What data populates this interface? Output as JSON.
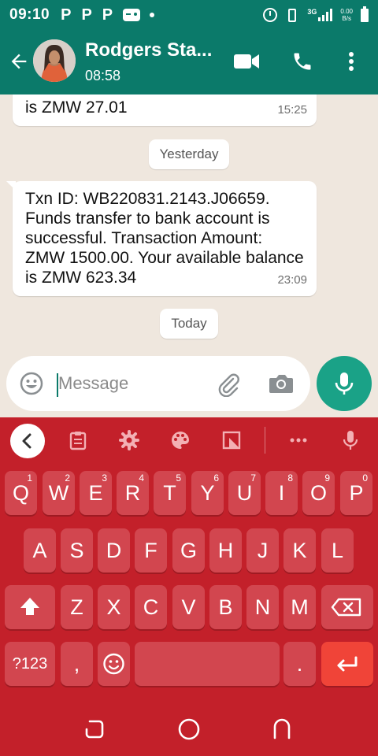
{
  "status_bar": {
    "time": "09:10",
    "notification_icons": [
      "P",
      "P",
      "P"
    ],
    "network_type": "3G",
    "speed_value": "0.00",
    "speed_unit": "B/s"
  },
  "header": {
    "contact_name": "Rodgers Sta...",
    "status": "08:58"
  },
  "messages": [
    {
      "text": "is ZMW 27.01",
      "time": "15:25"
    },
    {
      "text": "Txn ID: WB220831.2143.J06659. Funds transfer to bank account is successful. Transaction Amount: ZMW 1500.00. Your available balance is ZMW 623.34",
      "time": "23:09"
    }
  ],
  "date_chips": {
    "yesterday": "Yesterday",
    "today": "Today"
  },
  "composer": {
    "placeholder": "Message"
  },
  "keyboard": {
    "row1": [
      {
        "key": "Q",
        "hint": "1"
      },
      {
        "key": "W",
        "hint": "2"
      },
      {
        "key": "E",
        "hint": "3"
      },
      {
        "key": "R",
        "hint": "4"
      },
      {
        "key": "T",
        "hint": "5"
      },
      {
        "key": "Y",
        "hint": "6"
      },
      {
        "key": "U",
        "hint": "7"
      },
      {
        "key": "I",
        "hint": "8"
      },
      {
        "key": "O",
        "hint": "9"
      },
      {
        "key": "P",
        "hint": "0"
      }
    ],
    "row2": [
      "A",
      "S",
      "D",
      "F",
      "G",
      "H",
      "J",
      "K",
      "L"
    ],
    "row3": [
      "Z",
      "X",
      "C",
      "V",
      "B",
      "N",
      "M"
    ],
    "symbols_label": "?123",
    "comma_label": ",",
    "period_label": "."
  },
  "colors": {
    "header_green": "#0b7a6a",
    "chat_background": "#efe7de",
    "mic_green": "#1aa287",
    "keyboard_red": "#c3202a",
    "key_red": "#d2464f",
    "enter_red": "#f04438"
  },
  "icons": {
    "header": [
      "back-arrow-icon",
      "video-call-icon",
      "phone-icon",
      "more-vert-icon"
    ],
    "composer": [
      "emoji-icon",
      "attach-icon",
      "camera-icon",
      "mic-icon"
    ],
    "keyboard_toolbar": [
      "chevron-left-icon",
      "clipboard-icon",
      "settings-icon",
      "palette-icon",
      "resize-icon",
      "more-horiz-icon",
      "mic-icon"
    ]
  }
}
